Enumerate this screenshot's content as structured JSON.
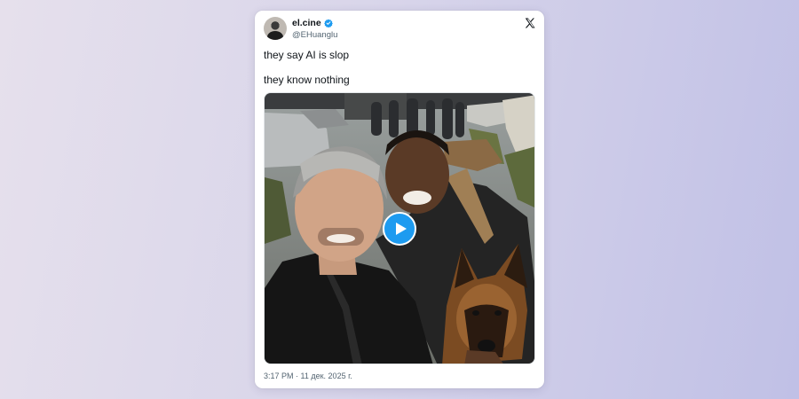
{
  "tweet": {
    "author": {
      "display_name": "el.cine",
      "handle": "@EHuanglu",
      "verified": true,
      "verified_badge_color": "#1d9bf0"
    },
    "platform_icon": "x-logo-icon",
    "text_line_1": "they say AI is slop",
    "text_line_2": "they know nothing",
    "media": {
      "kind": "video",
      "play_icon": "play-icon",
      "play_button_color": "#1d9bf0"
    },
    "timestamp": "3:17 PM · 11 дек. 2025 г."
  }
}
